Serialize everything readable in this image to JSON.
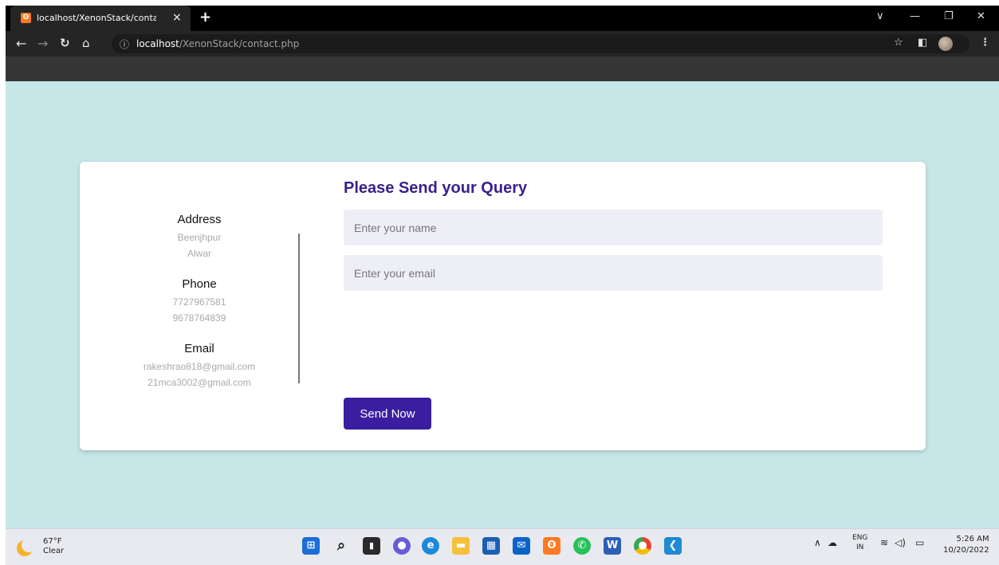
{
  "browser": {
    "tab_title": "localhost/XenonStack/contact.ph",
    "tab_close": "×",
    "new_tab": "+",
    "url_host": "localhost",
    "url_path": "/XenonStack/contact.php",
    "window_controls": {
      "dropdown": "∨",
      "minimize": "—",
      "restore": "❐",
      "close": "✕"
    }
  },
  "contact": {
    "address_heading": "Address",
    "address_line1": "Beenjhpur",
    "address_line2": "Alwar",
    "phone_heading": "Phone",
    "phone1": "7727967581",
    "phone2": "9678764839",
    "email_heading": "Email",
    "email1": "rakeshrao818@gmail.com",
    "email2": "21mca3002@gmail.com"
  },
  "form": {
    "title": "Please Send your Query",
    "name_placeholder": "Enter your name",
    "email_placeholder": "Enter your email",
    "submit_label": "Send Now"
  },
  "taskbar": {
    "temperature": "67°F",
    "condition": "Clear",
    "language": "ENG",
    "region": "IN",
    "time": "5:26 AM",
    "date": "10/20/2022"
  },
  "colors": {
    "page_background": "#c6e6e8",
    "accent": "#3a1ea0",
    "title": "#3a1f8c",
    "input_background": "#eeeef6"
  }
}
